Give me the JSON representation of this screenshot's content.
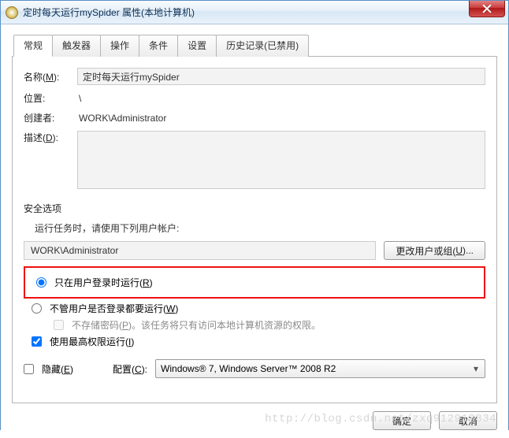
{
  "window": {
    "title": "定时每天运行mySpider 属性(本地计算机)"
  },
  "tabs": {
    "general": "常规",
    "triggers": "触发器",
    "actions": "操作",
    "conditions": "条件",
    "settings": "设置",
    "history": "历史记录(已禁用)"
  },
  "general": {
    "name_label": "名称(",
    "name_mnemonic": "M",
    "name_label_tail": "):",
    "name_value": "定时每天运行mySpider",
    "location_label": "位置:",
    "location_value": "\\",
    "creator_label": "创建者:",
    "creator_value": "WORK\\Administrator",
    "desc_label": "描述(",
    "desc_mnemonic": "D",
    "desc_label_tail": "):",
    "desc_value": ""
  },
  "security": {
    "title": "安全选项",
    "run_as_label": "运行任务时，请使用下列用户帐户:",
    "account": "WORK\\Administrator",
    "change_user_btn": "更改用户或组(",
    "change_user_mnemonic": "U",
    "change_user_tail": ")...",
    "radio_logged_on": "只在用户登录时运行(",
    "radio_logged_on_m": "R",
    "radio_logged_on_tail": ")",
    "radio_any": "不管用户是否登录都要运行(",
    "radio_any_m": "W",
    "radio_any_tail": ")",
    "no_store_pw": "不存储密码(",
    "no_store_pw_m": "P",
    "no_store_pw_tail": ")。该任务将只有访问本地计算机资源的权限。",
    "highest_priv": "使用最高权限运行(",
    "highest_priv_m": "I",
    "highest_priv_tail": ")"
  },
  "bottom": {
    "hidden_label": "隐藏(",
    "hidden_m": "E",
    "hidden_tail": ")",
    "configure_label": "配置(",
    "configure_m": "C",
    "configure_tail": "):",
    "configure_value": "Windows® 7, Windows Server™ 2008 R2"
  },
  "buttons": {
    "ok": "确定",
    "cancel": "取消"
  },
  "watermark": "http://blog.csdn.net/zxq912913834"
}
